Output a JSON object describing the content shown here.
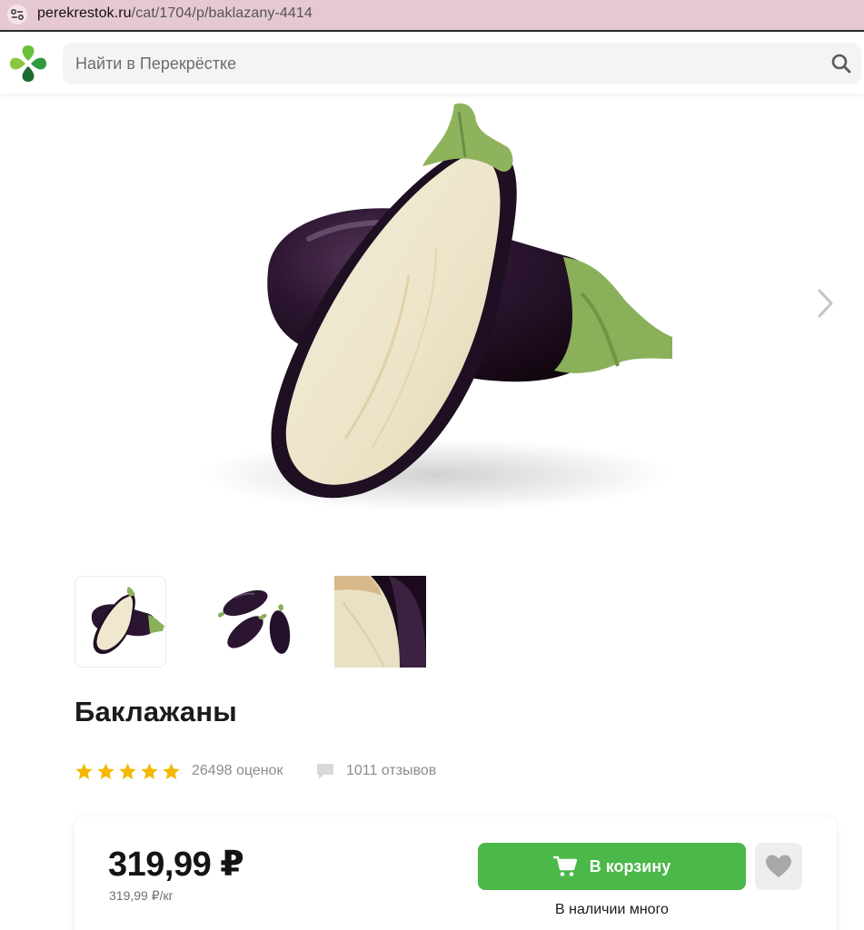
{
  "browser": {
    "url_host": "perekrestok.ru",
    "url_path": "/cat/1704/p/baklazany-4414",
    "site_icon": "tune-icon"
  },
  "header": {
    "logo_icon": "perekrestok-clover-icon",
    "search": {
      "placeholder": "Найти в Перекрёстке",
      "value": "",
      "icon": "search-icon"
    }
  },
  "gallery": {
    "next_icon": "chevron-right-icon",
    "thumbnails": [
      {
        "icon": "eggplant-halves-thumbnail",
        "selected": true
      },
      {
        "icon": "eggplant-three-thumbnail",
        "selected": false
      },
      {
        "icon": "eggplant-closeup-thumbnail",
        "selected": false
      }
    ]
  },
  "product": {
    "title": "Баклажаны",
    "rating": {
      "stars": 5,
      "max_stars": 5,
      "ratings_count": "26498 оценок"
    },
    "reviews_count": "1011 отзывов"
  },
  "buy": {
    "price": "319,99 ₽",
    "unit_price": "319,99 ₽/кг",
    "cart_label": "В корзину",
    "stock": "В наличии много"
  },
  "colors": {
    "brand_green": "#4bb84a",
    "star_gold": "#f5b800",
    "url_bar": "#e6c9d0"
  }
}
